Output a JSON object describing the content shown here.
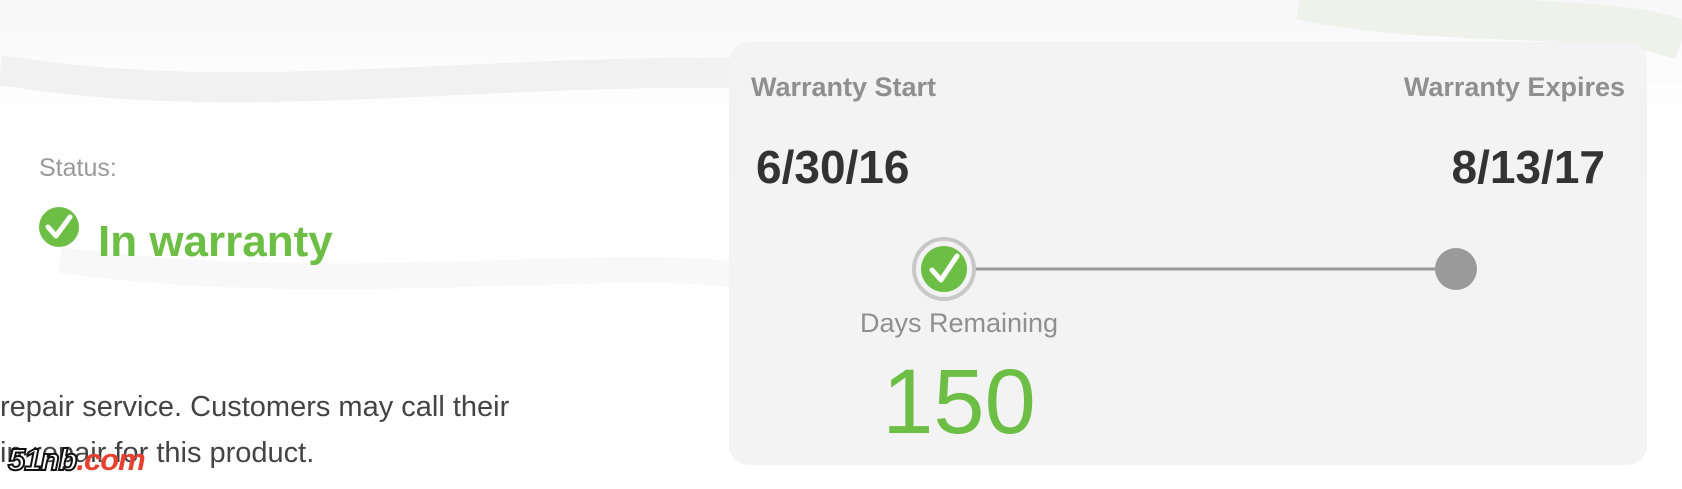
{
  "status": {
    "label": "Status:",
    "value": "In warranty",
    "icon": "check-circle-icon",
    "color": "#6cbe45"
  },
  "description": {
    "line1": "repair service. Customers may call their",
    "line2": "in-repair for this product."
  },
  "watermark": {
    "text_a": "51nb",
    "text_b": ".com"
  },
  "warranty": {
    "start_label": "Warranty Start",
    "start_date": "6/30/16",
    "expires_label": "Warranty Expires",
    "expires_date": "8/13/17",
    "days_remaining_label": "Days Remaining",
    "days_remaining": "150",
    "progress_fraction": 0.0,
    "track_color": "#9a9a9a",
    "accent_color": "#6cbe45"
  }
}
